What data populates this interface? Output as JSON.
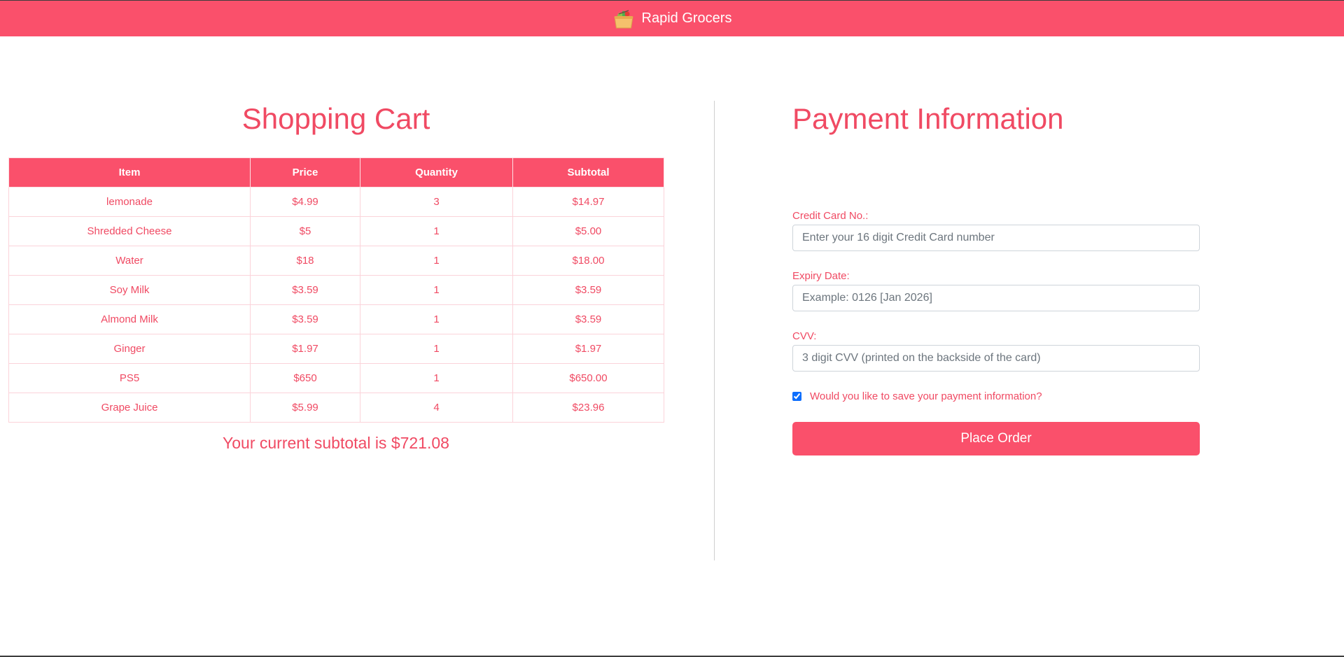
{
  "header": {
    "brand_name": "Rapid Grocers",
    "brand_icon": "grocery-basket-icon",
    "bg_color": "#fa506b"
  },
  "cart": {
    "title": "Shopping Cart",
    "columns": [
      "Item",
      "Price",
      "Quantity",
      "Subtotal"
    ],
    "rows": [
      {
        "item": "lemonade",
        "price": "$4.99",
        "quantity": "3",
        "subtotal": "$14.97"
      },
      {
        "item": "Shredded Cheese",
        "price": "$5",
        "quantity": "1",
        "subtotal": "$5.00"
      },
      {
        "item": "Water",
        "price": "$18",
        "quantity": "1",
        "subtotal": "$18.00"
      },
      {
        "item": "Soy Milk",
        "price": "$3.59",
        "quantity": "1",
        "subtotal": "$3.59"
      },
      {
        "item": "Almond Milk",
        "price": "$3.59",
        "quantity": "1",
        "subtotal": "$3.59"
      },
      {
        "item": "Ginger",
        "price": "$1.97",
        "quantity": "1",
        "subtotal": "$1.97"
      },
      {
        "item": "PS5",
        "price": "$650",
        "quantity": "1",
        "subtotal": "$650.00"
      },
      {
        "item": "Grape Juice",
        "price": "$5.99",
        "quantity": "4",
        "subtotal": "$23.96"
      }
    ],
    "subtotal_text": "Your current subtotal is $721.08"
  },
  "payment": {
    "title": "Payment Information",
    "card_label": "Credit Card No.:",
    "card_placeholder": "Enter your 16 digit Credit Card number",
    "card_value": "",
    "expiry_label": "Expiry Date:",
    "expiry_placeholder": "Example: 0126 [Jan 2026]",
    "expiry_value": "",
    "cvv_label": "CVV:",
    "cvv_placeholder": "3 digit CVV (printed on the backside of the card)",
    "cvv_value": "",
    "save_label": "Would you like to save your payment information?",
    "save_checked": true,
    "place_order_label": "Place Order"
  },
  "colors": {
    "accent": "#fa506b",
    "text_accent": "#f04a63"
  }
}
